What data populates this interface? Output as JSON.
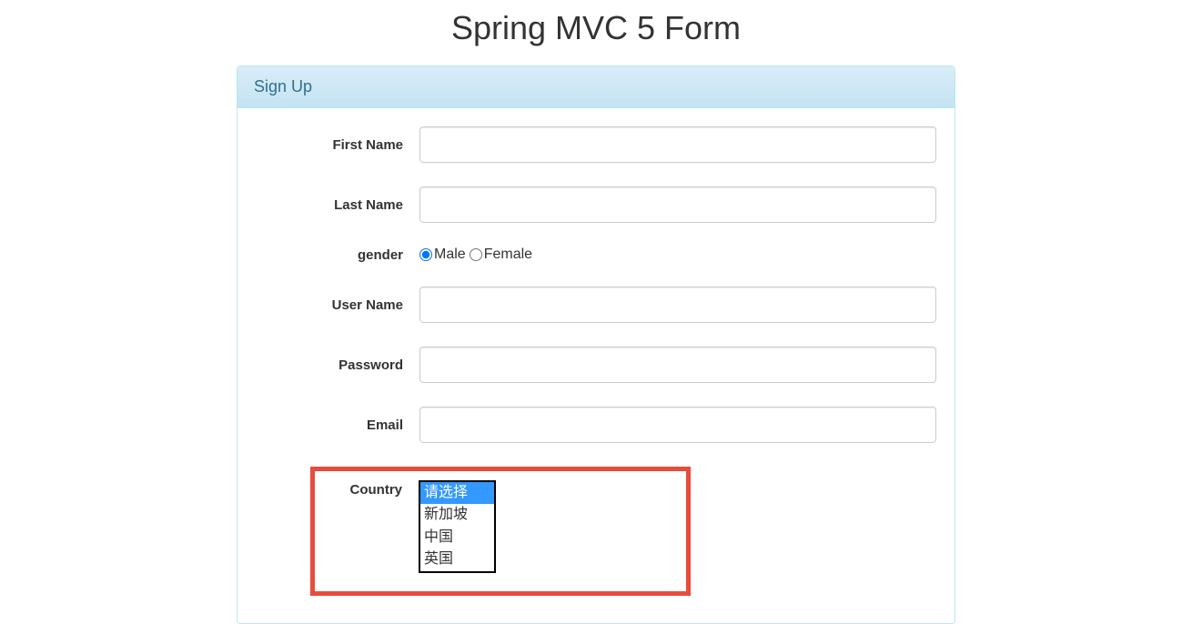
{
  "page": {
    "title": "Spring MVC 5 Form"
  },
  "panel": {
    "heading": "Sign Up"
  },
  "form": {
    "firstName": {
      "label": "First Name",
      "value": ""
    },
    "lastName": {
      "label": "Last Name",
      "value": ""
    },
    "gender": {
      "label": "gender",
      "options": {
        "male": "Male",
        "female": "Female"
      },
      "selected": "male"
    },
    "userName": {
      "label": "User Name",
      "value": ""
    },
    "password": {
      "label": "Password",
      "value": ""
    },
    "email": {
      "label": "Email",
      "value": ""
    },
    "country": {
      "label": "Country",
      "options": [
        "请选择",
        "新加坡",
        "中国",
        "英国"
      ],
      "selected": "请选择"
    }
  }
}
